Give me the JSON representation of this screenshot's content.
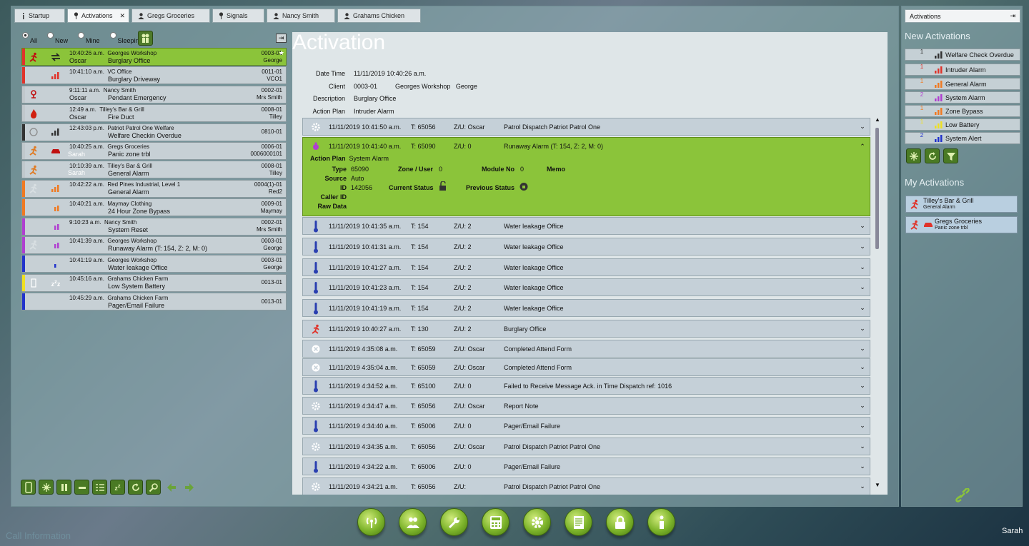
{
  "tabs": [
    {
      "label": "Startup",
      "icon": "info-icon"
    },
    {
      "label": "Activations",
      "icon": "pin-icon",
      "active": true,
      "closable": true
    },
    {
      "label": "Gregs Groceries",
      "icon": "person-icon"
    },
    {
      "label": "Signals",
      "icon": "pin-icon"
    },
    {
      "label": "Nancy Smith",
      "icon": "person-icon"
    },
    {
      "label": "Grahams Chicken",
      "icon": "person-icon"
    }
  ],
  "filters": {
    "all": "All",
    "new": "New",
    "mine": "Mine",
    "sleeping": "Sleeping",
    "selected": "All"
  },
  "activations": [
    {
      "time": "10:40:26 a.m.",
      "client": "Georges Workshop",
      "user": "Oscar",
      "desc": "Burglary Office",
      "code": "0003-01",
      "contact": "George",
      "bar": "#e0332a",
      "selected": true,
      "starred": true,
      "who": ""
    },
    {
      "time": "10:41:10 a.m.",
      "client": "VC Office",
      "user": "",
      "desc": "Burglary Driveway",
      "code": "0011-01",
      "contact": "VCO1",
      "bar": "#e0332a",
      "who": ""
    },
    {
      "time": "9:11:11 a.m.",
      "client": "Nancy Smith",
      "user": "Oscar",
      "desc": "Pendant Emergency",
      "code": "0002-01",
      "contact": "Mrs Smith",
      "bar": "#c0c8cc",
      "who": ""
    },
    {
      "time": "12:49 a.m.",
      "client": "Tilley's Bar & Grill",
      "user": "Oscar",
      "desc": "Fire Duct",
      "code": "0008-01",
      "contact": "Tilley",
      "bar": "#c0c8cc",
      "who": ""
    },
    {
      "time": "12:43:03 p.m.",
      "client": "Patriot Patrol One Welfare",
      "user": "",
      "desc": "Welfare Checkin Overdue",
      "code": "0810-01",
      "contact": "",
      "bar": "#333",
      "who": ""
    },
    {
      "time": "10:40:25 a.m.",
      "client": "Gregs Groceries",
      "user": "",
      "desc": "Panic zone trbl",
      "code": "0006-01",
      "contact": "0006000101",
      "bar": "#c0c8cc",
      "who": "Sarah"
    },
    {
      "time": "10:10:39 a.m.",
      "client": "Tilley's Bar & Grill",
      "user": "",
      "desc": "General Alarm",
      "code": "0008-01",
      "contact": "Tilley",
      "bar": "#c0c8cc",
      "who": "Sarah"
    },
    {
      "time": "10:42:22 a.m.",
      "client": "Red Pines Industrial, Level 1",
      "user": "",
      "desc": "General Alarm",
      "code": "0004(1)-01",
      "contact": "Red2",
      "bar": "#f07a22",
      "who": ""
    },
    {
      "time": "10:40:21 a.m.",
      "client": "Maymay Clothing",
      "user": "",
      "desc": "24 Hour Zone Bypass",
      "code": "0009-01",
      "contact": "Maymay",
      "bar": "#f07a22",
      "who": ""
    },
    {
      "time": "9:10:23 a.m.",
      "client": "Nancy Smith",
      "user": "",
      "desc": "System Reset",
      "code": "0002-01",
      "contact": "Mrs Smith",
      "bar": "#b040d0",
      "who": ""
    },
    {
      "time": "10:41:39 a.m.",
      "client": "Georges Workshop",
      "user": "",
      "desc": "Runaway Alarm  (T: 154, Z: 2, M: 0)",
      "code": "0003-01",
      "contact": "George",
      "bar": "#b040d0",
      "who": ""
    },
    {
      "time": "10:41:19 a.m.",
      "client": "Georges Workshop",
      "user": "",
      "desc": "Water leakage Office",
      "code": "0003-01",
      "contact": "George",
      "bar": "#2233cc",
      "who": ""
    },
    {
      "time": "10:45:16 a.m.",
      "client": "Grahams Chicken Farm",
      "user": "",
      "desc": "Low System Battery",
      "code": "0013-01",
      "contact": "",
      "bar": "#f0e020",
      "who": ""
    },
    {
      "time": "10:45:29 a.m.",
      "client": "Grahams Chicken Farm",
      "user": "",
      "desc": "Pager/Email Failure",
      "code": "0013-01",
      "contact": "",
      "bar": "#2233cc",
      "who": ""
    }
  ],
  "detail": {
    "title": "Activation",
    "info": [
      {
        "k": "Date Time",
        "v": "11/11/2019 10:40:26 a.m."
      },
      {
        "k": "Client",
        "v": "0003-01          Georges Workshop   George"
      },
      {
        "k": "Description",
        "v": "Burglary Office"
      },
      {
        "k": "Action Plan",
        "v": "Intruder Alarm"
      }
    ],
    "expanded": {
      "dt": "11/11/2019 10:41:40 a.m.",
      "t": "T:  65090",
      "zu": "Z/U:  0",
      "desc": "Runaway Alarm  (T: 154, Z: 2, M: 0)",
      "action_plan_label": "Action Plan",
      "action_plan": "System Alarm",
      "type_label": "Type",
      "type": "65090",
      "zone_label": "Zone / User",
      "zone": "0",
      "module_label": "Module No",
      "module": "0",
      "memo_label": "Memo",
      "source_label": "Source",
      "source": "Auto",
      "id_label": "ID",
      "id": "142056",
      "current_label": "Current Status",
      "previous_label": "Previous Status",
      "caller_label": "Caller ID",
      "raw_label": "Raw Data"
    },
    "events": [
      {
        "dt": "11/11/2019 10:41:50 a.m.",
        "t": "T:  65056",
        "zu": "Z/U:  Oscar",
        "desc": "Patrol Dispatch Patriot Patrol One",
        "icon": "gear"
      },
      {
        "dt": "11/11/2019 10:41:35 a.m.",
        "t": "T:  154",
        "zu": "Z/U:  2",
        "desc": "Water leakage Office",
        "icon": "therm"
      },
      {
        "dt": "11/11/2019 10:41:31 a.m.",
        "t": "T:  154",
        "zu": "Z/U:  2",
        "desc": "Water leakage Office",
        "icon": "therm"
      },
      {
        "dt": "11/11/2019 10:41:27 a.m.",
        "t": "T:  154",
        "zu": "Z/U:  2",
        "desc": "Water leakage Office",
        "icon": "therm"
      },
      {
        "dt": "11/11/2019 10:41:23 a.m.",
        "t": "T:  154",
        "zu": "Z/U:  2",
        "desc": "Water leakage Office",
        "icon": "therm"
      },
      {
        "dt": "11/11/2019 10:41:19 a.m.",
        "t": "T:  154",
        "zu": "Z/U:  2",
        "desc": "Water leakage Office",
        "icon": "therm"
      },
      {
        "dt": "11/11/2019 10:40:27 a.m.",
        "t": "T:  130",
        "zu": "Z/U:  2",
        "desc": "Burglary Office",
        "icon": "runner"
      },
      {
        "dt": "11/11/2019 4:35:08 a.m.",
        "t": "T:  65059",
        "zu": "Z/U:  Oscar",
        "desc": "Completed Attend Form",
        "icon": "x"
      },
      {
        "dt": "11/11/2019 4:35:04 a.m.",
        "t": "T:  65059",
        "zu": "Z/U:  Oscar",
        "desc": "Completed Attend Form",
        "icon": "x"
      },
      {
        "dt": "11/11/2019 4:34:52 a.m.",
        "t": "T:  65100",
        "zu": "Z/U:  0",
        "desc": "Failed to Receive Message Ack. in Time  Dispatch ref: 1016",
        "icon": "therm"
      },
      {
        "dt": "11/11/2019 4:34:47 a.m.",
        "t": "T:  65056",
        "zu": "Z/U:  Oscar",
        "desc": "Report Note",
        "icon": "gear"
      },
      {
        "dt": "11/11/2019 4:34:40 a.m.",
        "t": "T:  65006",
        "zu": "Z/U:  0",
        "desc": "Pager/Email Failure",
        "icon": "therm"
      },
      {
        "dt": "11/11/2019 4:34:35 a.m.",
        "t": "T:  65056",
        "zu": "Z/U:  Oscar",
        "desc": "Patrol Dispatch Patriot Patrol One",
        "icon": "gear"
      },
      {
        "dt": "11/11/2019 4:34:22 a.m.",
        "t": "T:  65006",
        "zu": "Z/U:  0",
        "desc": "Pager/Email Failure",
        "icon": "therm"
      },
      {
        "dt": "11/11/2019 4:34:21 a.m.",
        "t": "T:  65056",
        "zu": "Z/U:",
        "desc": "Patrol Dispatch Patriot Patrol One",
        "icon": "gear"
      }
    ]
  },
  "right": {
    "tab": "Activations",
    "new_heading": "New Activations",
    "new_items": [
      {
        "count": "1",
        "label": "Welfare Check Overdue",
        "color": "#333"
      },
      {
        "count": "1",
        "label": "Intruder Alarm",
        "color": "#e0332a"
      },
      {
        "count": "1",
        "label": "General Alarm",
        "color": "#f07a22"
      },
      {
        "count": "2",
        "label": "System Alarm",
        "color": "#b040d0"
      },
      {
        "count": "1",
        "label": "Zone Bypass",
        "color": "#f07a22"
      },
      {
        "count": "1",
        "label": "Low Battery",
        "color": "#f0e020"
      },
      {
        "count": "2",
        "label": "System Alert",
        "color": "#2233cc"
      }
    ],
    "my_heading": "My Activations",
    "my_items": [
      {
        "title": "Tilley's Bar & Grill",
        "sub": "General Alarm"
      },
      {
        "title": "Gregs Groceries",
        "sub": "Panic zone trbl"
      }
    ]
  },
  "call_info": "Call Information",
  "user": "Sarah"
}
